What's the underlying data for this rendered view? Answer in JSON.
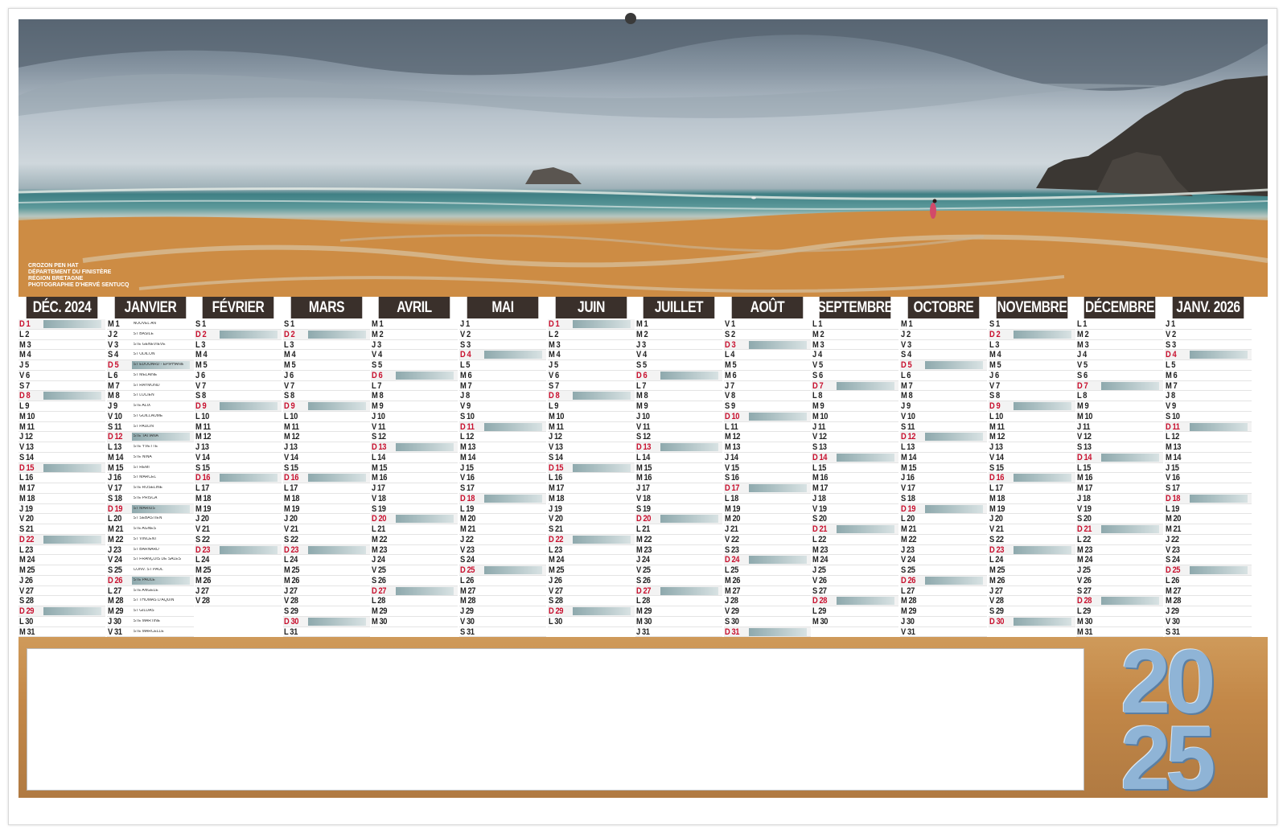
{
  "photo_credits": [
    "CROZON PEN HAT",
    "DÉPARTEMENT DU FINISTÈRE",
    "RÉGION BRETAGNE",
    "PHOTOGRAPHIE D'HERVÉ SENTUCQ"
  ],
  "year_top": "20",
  "year_bottom": "25",
  "months": [
    {
      "name": "DÉC. 2024",
      "start": 0,
      "days": 31
    },
    {
      "name": "JANVIER",
      "start": 3,
      "days": 31
    },
    {
      "name": "FÉVRIER",
      "start": 6,
      "days": 28
    },
    {
      "name": "MARS",
      "start": 6,
      "days": 31
    },
    {
      "name": "AVRIL",
      "start": 2,
      "days": 30
    },
    {
      "name": "MAI",
      "start": 4,
      "days": 31
    },
    {
      "name": "JUIN",
      "start": 0,
      "days": 30
    },
    {
      "name": "JUILLET",
      "start": 2,
      "days": 31
    },
    {
      "name": "AOÛT",
      "start": 5,
      "days": 31
    },
    {
      "name": "SEPTEMBRE",
      "start": 1,
      "days": 30
    },
    {
      "name": "OCTOBRE",
      "start": 3,
      "days": 31
    },
    {
      "name": "NOVEMBRE",
      "start": 6,
      "days": 30
    },
    {
      "name": "DÉCEMBRE",
      "start": 1,
      "days": 31
    },
    {
      "name": "JANV. 2026",
      "start": 4,
      "days": 31
    }
  ],
  "weekday_letters": [
    "D",
    "L",
    "M",
    "M",
    "J",
    "V",
    "S"
  ],
  "january_saints": [
    "NOUVEL AN",
    "ST BASILE",
    "STE GENEVIÈVE",
    "ST ODILON",
    "ST ÉDOUARD - ÉPIPHANIE",
    "ST MÉLAINE",
    "ST RAYMOND",
    "ST LUCIEN",
    "STE ALIX",
    "ST GUILLAUME",
    "ST PAULIN",
    "STE TATIANA",
    "STE YVETTE",
    "STE NINA",
    "ST RÉMI",
    "ST MARCEL",
    "STE ROSELINE",
    "STE PRISCA",
    "ST MARIUS",
    "ST SÉBASTIEN",
    "STE AGNÈS",
    "ST VINCENT",
    "ST BARNARD",
    "ST FRANÇOIS DE SALES",
    "CONV. ST PAUL",
    "STE PAULE",
    "STE ANGÈLE",
    "ST THOMAS D'AQUIN",
    "ST GILDAS",
    "STE MARTINE",
    "STE MARCELLE"
  ]
}
